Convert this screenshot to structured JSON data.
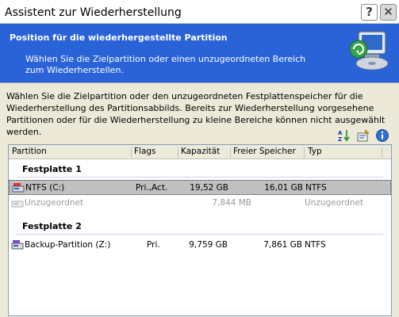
{
  "window": {
    "title": "Assistent zur Wiederherstellung",
    "help_glyph": "?",
    "close_glyph": "✕"
  },
  "header": {
    "title": "Position für die wiederhergestellte Partition",
    "subtitle": "Wählen Sie die Zielpartition oder einen unzugeordneten Bereich zum Wiederherstellen.",
    "icon": "backup-restore-computer-icon"
  },
  "description": "Wählen Sie die Zielpartition oder den unzugeordneten Festplattenspeicher für die  Wiederherstellung des Partitionsabbilds. Bereits zur Wiederherstellung vorgesehene Partitionen oder für die Wiederherstellung zu kleine Bereiche können nicht ausgewählt werden.",
  "toolbar": {
    "icons": [
      "sort-icon",
      "properties-icon",
      "info-icon"
    ]
  },
  "table": {
    "columns": {
      "partition": "Partition",
      "flags": "Flags",
      "capacity": "Kapazität",
      "free": "Freier Speicher",
      "type": "Typ"
    },
    "groups": [
      {
        "name": "Festplatte 1",
        "rows": [
          {
            "partition": "NTFS (C:)",
            "flags": "Pri.,Act.",
            "capacity": "19,52 GB",
            "free": "16,01 GB",
            "type": "NTFS",
            "selected": true,
            "enabled": true
          },
          {
            "partition": "Unzugeordnet",
            "flags": "",
            "capacity": "7,844 MB",
            "free": "",
            "type": "Unzugeordnet",
            "selected": false,
            "enabled": false
          }
        ]
      },
      {
        "name": "Festplatte 2",
        "rows": [
          {
            "partition": "Backup-Partition (Z:)",
            "flags": "Pri.",
            "capacity": "9,759 GB",
            "free": "7,861 GB",
            "type": "NTFS",
            "selected": false,
            "enabled": true
          }
        ]
      }
    ]
  },
  "colors": {
    "header_blue": "#2a62d8",
    "dialog_bg": "#ece9d8",
    "selection": "#c0c0c0",
    "list_border": "#7f9db9"
  }
}
